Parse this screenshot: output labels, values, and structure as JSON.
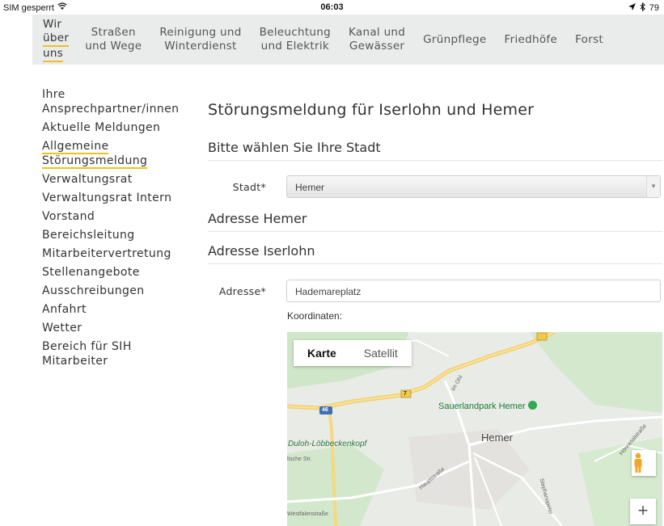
{
  "status_bar": {
    "carrier": "SIM gesperrt",
    "time": "06:03",
    "battery": "79"
  },
  "nav": {
    "items": [
      {
        "line1": "Wir",
        "line2": "über",
        "line3": "uns",
        "active": true
      },
      {
        "line1": "Straßen",
        "line2": "und Wege"
      },
      {
        "line1": "Reinigung und",
        "line2": "Winterdienst"
      },
      {
        "line1": "Beleuchtung",
        "line2": "und Elektrik"
      },
      {
        "line1": "Kanal und",
        "line2": "Gewässer"
      },
      {
        "line1": "Grünpflege"
      },
      {
        "line1": "Friedhöfe"
      },
      {
        "line1": "Forst"
      }
    ]
  },
  "sidebar": {
    "items": [
      {
        "label": "Ihre Ansprechpartner/innen"
      },
      {
        "label": "Aktuelle Meldungen"
      },
      {
        "label": "Allgemeine Störungsmeldung",
        "active": true
      },
      {
        "label": "Verwaltungsrat"
      },
      {
        "label": "Verwaltungsrat Intern"
      },
      {
        "label": "Vorstand"
      },
      {
        "label": "Bereichsleitung"
      },
      {
        "label": "Mitarbeitervertretung"
      },
      {
        "label": "Stellenangebote"
      },
      {
        "label": "Ausschreibungen"
      },
      {
        "label": "Anfahrt"
      },
      {
        "label": "Wetter"
      },
      {
        "label": "Bereich für SIH Mitarbeiter"
      }
    ]
  },
  "main": {
    "title": "Störungsmeldung für Iserlohn und Hemer",
    "city_section": "Bitte wählen Sie Ihre Stadt",
    "city_label": "Stadt*",
    "city_value": "Hemer",
    "address_hemer": "Adresse Hemer",
    "address_iserlohn": "Adresse Iserlohn",
    "address_label": "Adresse*",
    "address_value": "Hademareplatz",
    "coords_label": "Koordinaten:"
  },
  "map": {
    "type_map": "Karte",
    "type_satellite": "Satellit",
    "poi": "Sauerlandpark Hemer",
    "city": "Hemer",
    "district": "Duloh-Löbbeckenkopf",
    "road_7": "7",
    "road_46": "46",
    "zoom_in": "+",
    "street_1": "Westfalenstraße",
    "street_2": "Hauptstraße",
    "street_3": "Hönnetalstraße",
    "street_4": "Stephanopeler",
    "street_5": "lische Str.",
    "street_6": "Im Ohl",
    "colors": {
      "park": "#c8e6c3",
      "highway": "#f5d271",
      "road": "#ffffff",
      "poi": "#34a853"
    }
  }
}
